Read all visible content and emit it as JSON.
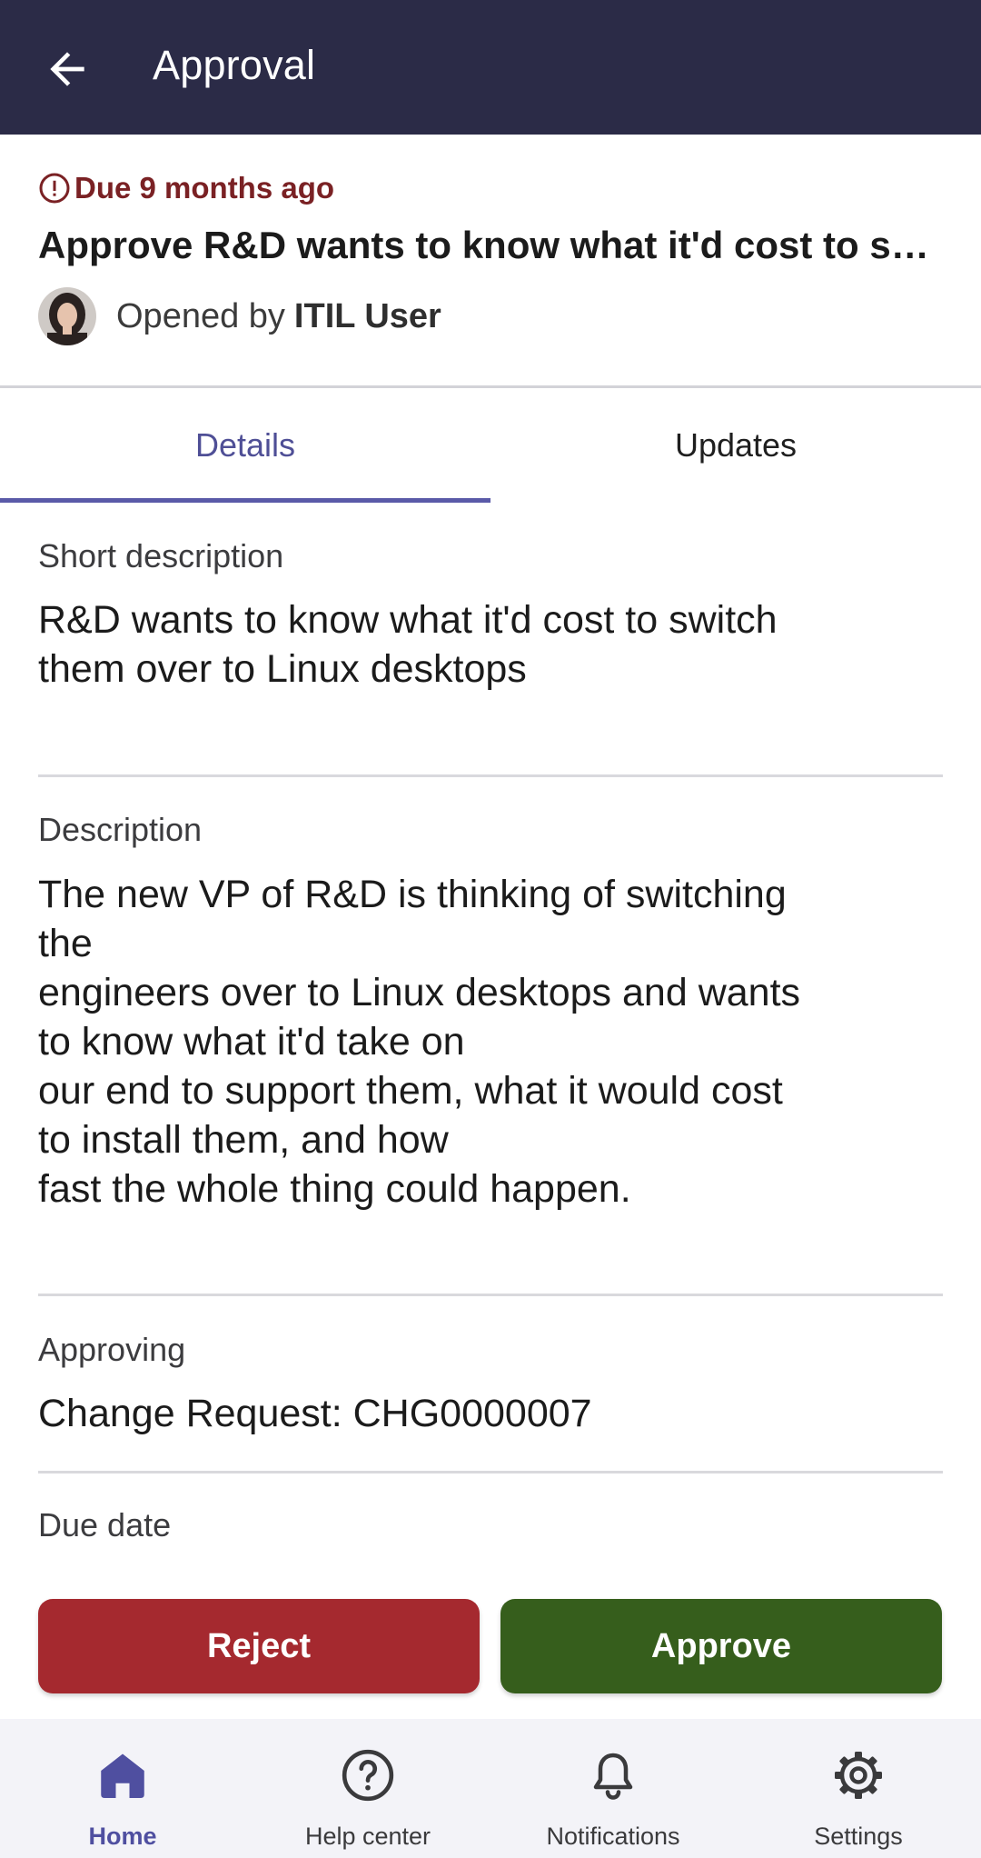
{
  "appbar": {
    "title": "Approval"
  },
  "header": {
    "due_text": "Due 9 months ago",
    "title": "Approve R&D wants to know what it'd cost to switch them over to Linux desktops",
    "opened_by_prefix": "Opened by",
    "opened_by_name": "ITIL User"
  },
  "tabs": [
    {
      "label": "Details",
      "active": true
    },
    {
      "label": "Updates",
      "active": false
    }
  ],
  "fields": {
    "short_description": {
      "label": "Short description",
      "value": "R&D wants to know what it'd cost to switch\nthem over to Linux desktops"
    },
    "description": {
      "label": "Description",
      "value": "The new VP of R&D is thinking of switching\nthe\nengineers over to Linux desktops and wants\nto know what it'd take on\nour end to support them, what it would cost\nto install them, and how\nfast the whole thing could happen."
    },
    "approving": {
      "label": "Approving",
      "value": "Change Request: CHG0000007"
    },
    "due_date": {
      "label": "Due date"
    }
  },
  "actions": {
    "reject_label": "Reject",
    "approve_label": "Approve"
  },
  "nav": [
    {
      "label": "Home",
      "icon": "home-icon",
      "active": true
    },
    {
      "label": "Help center",
      "icon": "help-circle-icon",
      "active": false
    },
    {
      "label": "Notifications",
      "icon": "bell-icon",
      "active": false
    },
    {
      "label": "Settings",
      "icon": "gear-icon",
      "active": false
    }
  ],
  "colors": {
    "appbar": "#2b2b47",
    "due": "#7a2124",
    "accent": "#4f4fa0",
    "reject": "#a5292f",
    "approve": "#365e1c",
    "nav_bg": "#f3f3f8"
  }
}
